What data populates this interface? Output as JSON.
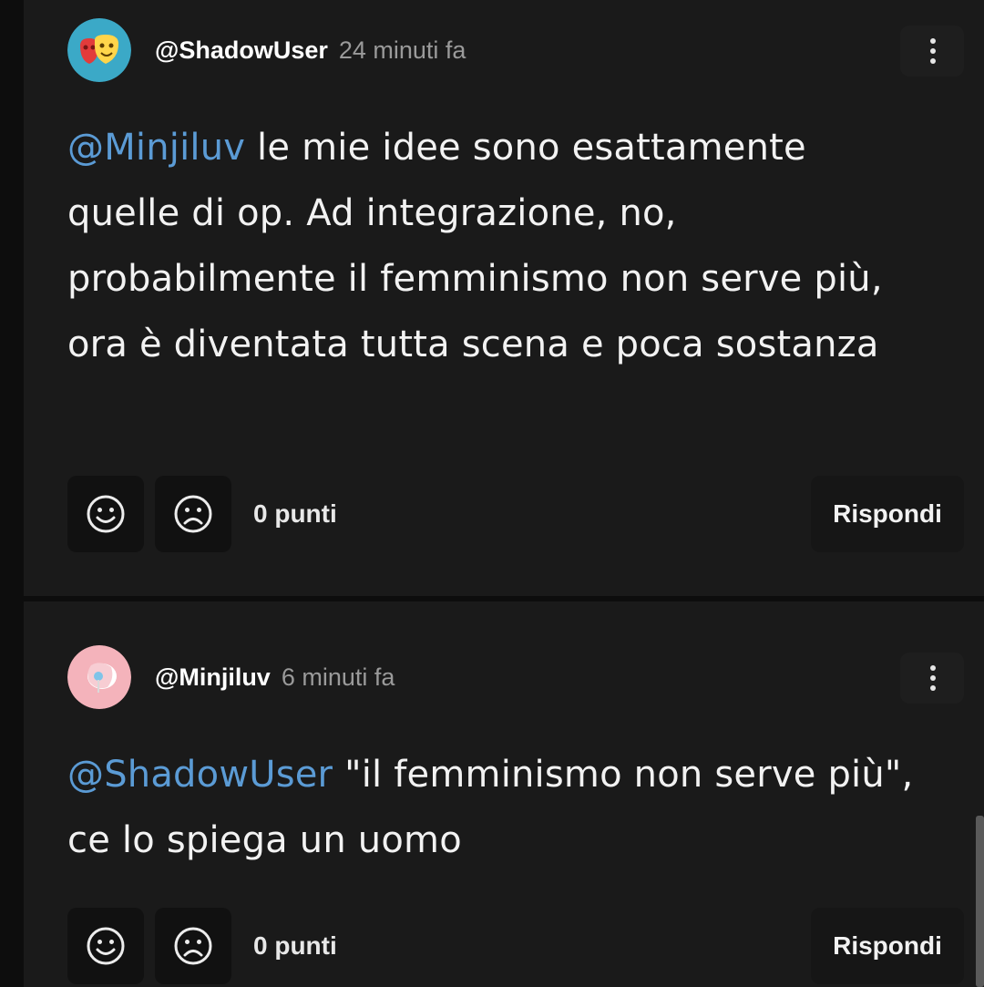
{
  "comments": [
    {
      "username": "@ShadowUser",
      "timestamp": "24 minuti fa",
      "mention": "@Minjiluv",
      "text": " le mie idee sono esattamente quelle di op. Ad integrazione, no, probabilmente il femminismo non serve più, ora è diventata tutta scena e poca sostanza",
      "points": "0 punti",
      "reply_label": "Rispondi",
      "avatar_icon": "theatre-masks-icon"
    },
    {
      "username": "@Minjiluv",
      "timestamp": "6 minuti fa",
      "mention": "@ShadowUser",
      "text": " \"il femminismo non serve più\", ce lo spiega un uomo",
      "points": "0 punti",
      "reply_label": "Rispondi",
      "avatar_icon": "lollipop-icon"
    }
  ],
  "icons": {
    "upvote": "smile-icon",
    "downvote": "frown-icon",
    "more": "more-vertical-icon"
  },
  "colors": {
    "background": "#1a1a1a",
    "mention": "#5b9bd5",
    "text": "#f2f2f2",
    "muted": "#9a9a9a"
  }
}
